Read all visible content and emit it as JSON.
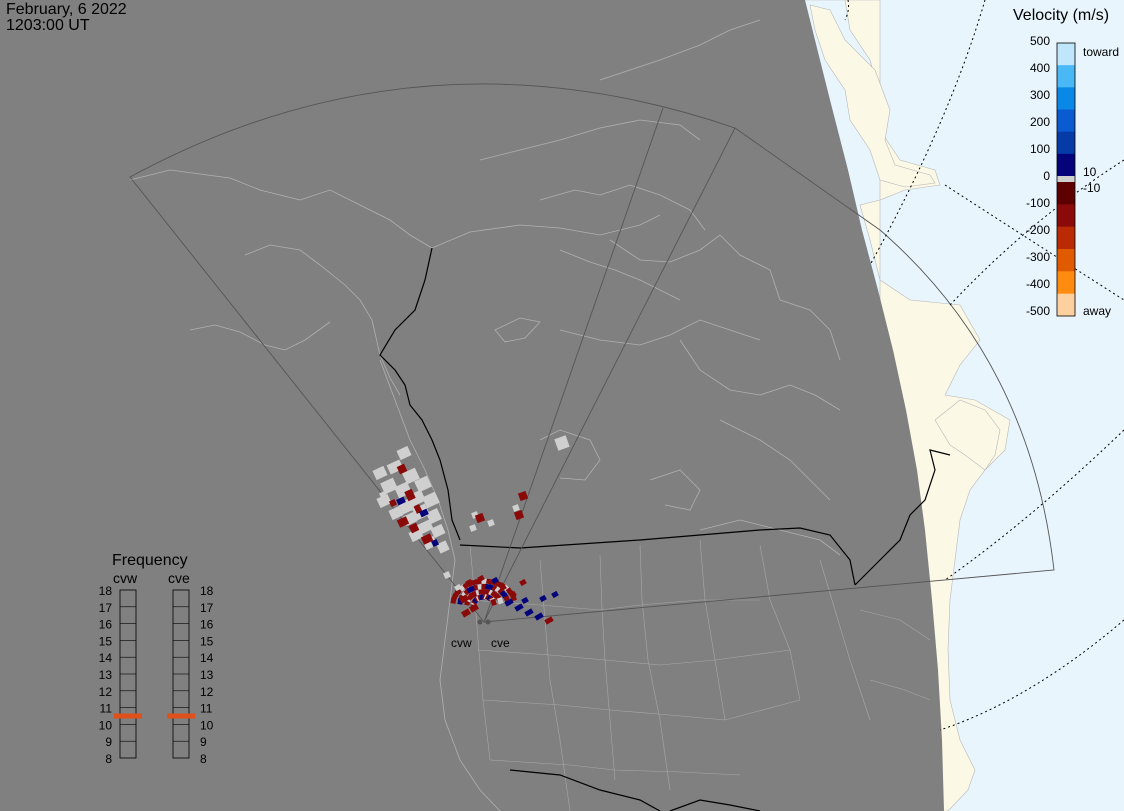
{
  "header": {
    "date": "February, 6 2022",
    "time": "1203:00 UT"
  },
  "sites": [
    {
      "code": "cvw"
    },
    {
      "code": "cve"
    }
  ],
  "velocity_legend": {
    "title": "Velocity (m/s)",
    "ticks": [
      "500",
      "400",
      "300",
      "200",
      "100",
      "0",
      "-100",
      "-200",
      "-300",
      "-400",
      "-500"
    ],
    "toward_label": "toward",
    "away_label": "away",
    "plus_threshold": "10",
    "minus_threshold": "-10",
    "colors": {
      "toward_500": "#bfe6fb",
      "toward_400": "#4ab8f5",
      "toward_300": "#0a88e8",
      "toward_200": "#0a5bd0",
      "toward_100": "#063aa6",
      "toward_0": "#04037a",
      "away_0": "#5c0000",
      "away_100": "#8a0a0a",
      "away_200": "#b92a05",
      "away_300": "#e05a00",
      "away_400": "#ff8c10",
      "away_500": "#fdd0a0",
      "ground_scatter": "#cfcfcf"
    }
  },
  "frequency_panel": {
    "title": "Frequency",
    "columns": [
      {
        "label": "cvw",
        "selected": "10.5"
      },
      {
        "label": "cve",
        "selected": "10.5"
      }
    ],
    "ticks": [
      "18",
      "17",
      "16",
      "15",
      "14",
      "13",
      "12",
      "11",
      "10",
      "9",
      "8"
    ],
    "indicator_color": "#e0501a"
  },
  "map_colors": {
    "night": "#808080",
    "day_ocean": "#e8f5fd",
    "day_land": "#fbf8e6",
    "coast_line": "#b8b8b8",
    "border_line": "#000000",
    "fov_line": "#555555"
  }
}
